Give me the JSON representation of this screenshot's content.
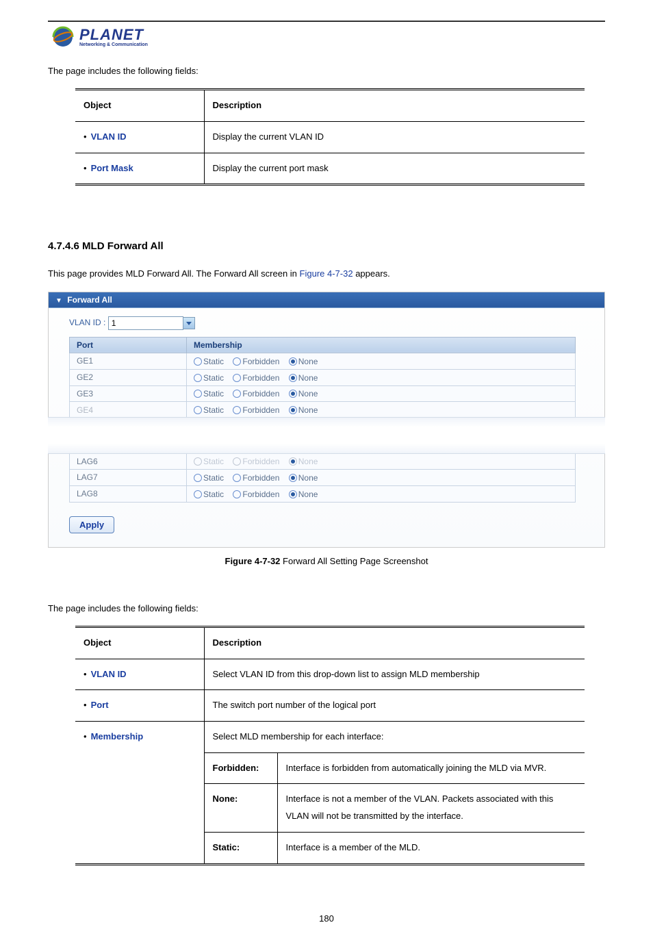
{
  "logo": {
    "main": "PLANET",
    "sub": "Networking & Communication"
  },
  "intro1": "The page includes the following fields:",
  "table1": {
    "headers": {
      "object": "Object",
      "description": "Description"
    },
    "rows": [
      {
        "object": "VLAN ID",
        "desc": "Display the current VLAN ID"
      },
      {
        "object": "Port Mask",
        "desc": "Display the current port mask"
      }
    ]
  },
  "section_heading": "4.7.4.6 MLD Forward All",
  "section_text_pre": "This page provides MLD Forward All. The Forward All screen in ",
  "section_text_link": "Figure 4-7-32",
  "section_text_post": " appears.",
  "panel": {
    "title": "Forward All",
    "vlan_label": "VLAN ID :",
    "vlan_value": "1",
    "headers": {
      "port": "Port",
      "membership": "Membership"
    },
    "opts": {
      "static": "Static",
      "forbidden": "Forbidden",
      "none": "None"
    },
    "rows_top": [
      "GE1",
      "GE2",
      "GE3"
    ],
    "row_cut": "GE4",
    "rows_bot": [
      "LAG6",
      "LAG7",
      "LAG8"
    ],
    "apply": "Apply"
  },
  "figure_caption_num": "Figure 4-7-32",
  "figure_caption_text": " Forward All Setting Page Screenshot",
  "intro2": "The page includes the following fields:",
  "table2": {
    "headers": {
      "object": "Object",
      "description": "Description"
    },
    "rows": [
      {
        "object": "VLAN ID",
        "desc": "Select VLAN ID from this drop-down list to assign MLD membership"
      },
      {
        "object": "Port",
        "desc": "The switch port number of the logical port"
      }
    ],
    "membership": {
      "object": "Membership",
      "intro": "Select MLD membership for each interface:",
      "items": [
        {
          "k": "Forbidden:",
          "v": "Interface is forbidden from automatically joining the MLD via MVR."
        },
        {
          "k": "None:",
          "v": "Interface is not a member of the VLAN. Packets associated with this VLAN will not be transmitted by the interface."
        },
        {
          "k": "Static:",
          "v": "Interface is a member of the MLD."
        }
      ]
    }
  },
  "page_number": "180"
}
